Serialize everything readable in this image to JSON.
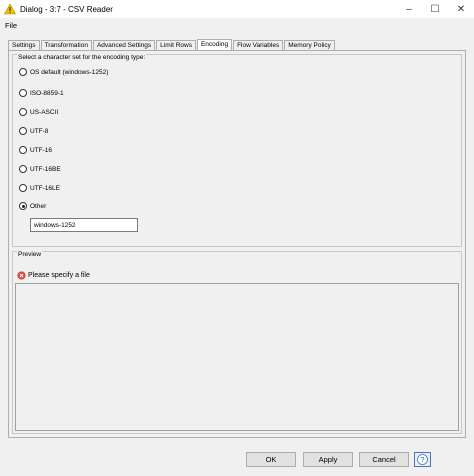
{
  "window": {
    "title": "Dialog - 3:7 - CSV Reader",
    "controls": [
      "–",
      "☐",
      "✕"
    ]
  },
  "menu": {
    "items": [
      "File"
    ]
  },
  "tabs": [
    "Settings",
    "Transformation",
    "Advanced Settings",
    "Limit Rows",
    "Encoding",
    "Flow Variables",
    "Memory Policy"
  ],
  "active_tab": "Encoding",
  "encoding": {
    "legend": "Select a character set for the encoding type:",
    "options": [
      "OS default (windows-1252)",
      "ISO-8859-1",
      "US-ASCII",
      "UTF-8",
      "UTF-16",
      "UTF-16BE",
      "UTF-16LE",
      "Other"
    ],
    "selected": "Other",
    "other_value": "windows-1252"
  },
  "preview": {
    "legend": "Preview",
    "error_text": "Please specify a file"
  },
  "buttons": {
    "ok": "OK",
    "apply": "Apply",
    "cancel": "Cancel",
    "help": "?"
  },
  "colors": {
    "error_icon": "#e0463a",
    "warning_icon": "#f2c200",
    "help_border": "#4a73b8"
  }
}
